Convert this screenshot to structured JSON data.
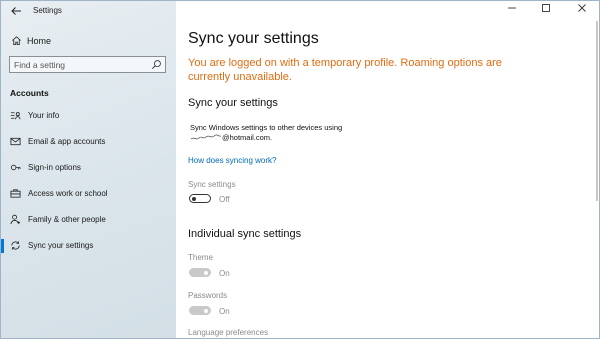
{
  "window": {
    "title": "Settings"
  },
  "sidebar": {
    "home_label": "Home",
    "search_placeholder": "Find a setting",
    "section_title": "Accounts",
    "items": [
      {
        "label": "Your info",
        "icon": "user-info-icon"
      },
      {
        "label": "Email & app accounts",
        "icon": "mail-icon"
      },
      {
        "label": "Sign-in options",
        "icon": "key-icon"
      },
      {
        "label": "Access work or school",
        "icon": "briefcase-icon"
      },
      {
        "label": "Family & other people",
        "icon": "person-add-icon"
      },
      {
        "label": "Sync your settings",
        "icon": "sync-icon",
        "active": true
      }
    ]
  },
  "main": {
    "title": "Sync your settings",
    "warning": "You are logged on with a temporary profile. Roaming options are currently unavailable.",
    "sync_section": {
      "heading": "Sync your settings",
      "description": "Sync Windows settings to other devices using",
      "email": "@hotmail.com.",
      "link": "How does syncing work?",
      "toggle_label": "Sync settings",
      "toggle_state": "Off"
    },
    "individual_section": {
      "heading": "Individual sync settings",
      "items": [
        {
          "label": "Theme",
          "state": "On"
        },
        {
          "label": "Passwords",
          "state": "On"
        },
        {
          "label": "Language preferences",
          "state": ""
        }
      ]
    }
  },
  "colors": {
    "accent": "#0078d7",
    "warning": "#e06c12",
    "link": "#0069b6"
  }
}
